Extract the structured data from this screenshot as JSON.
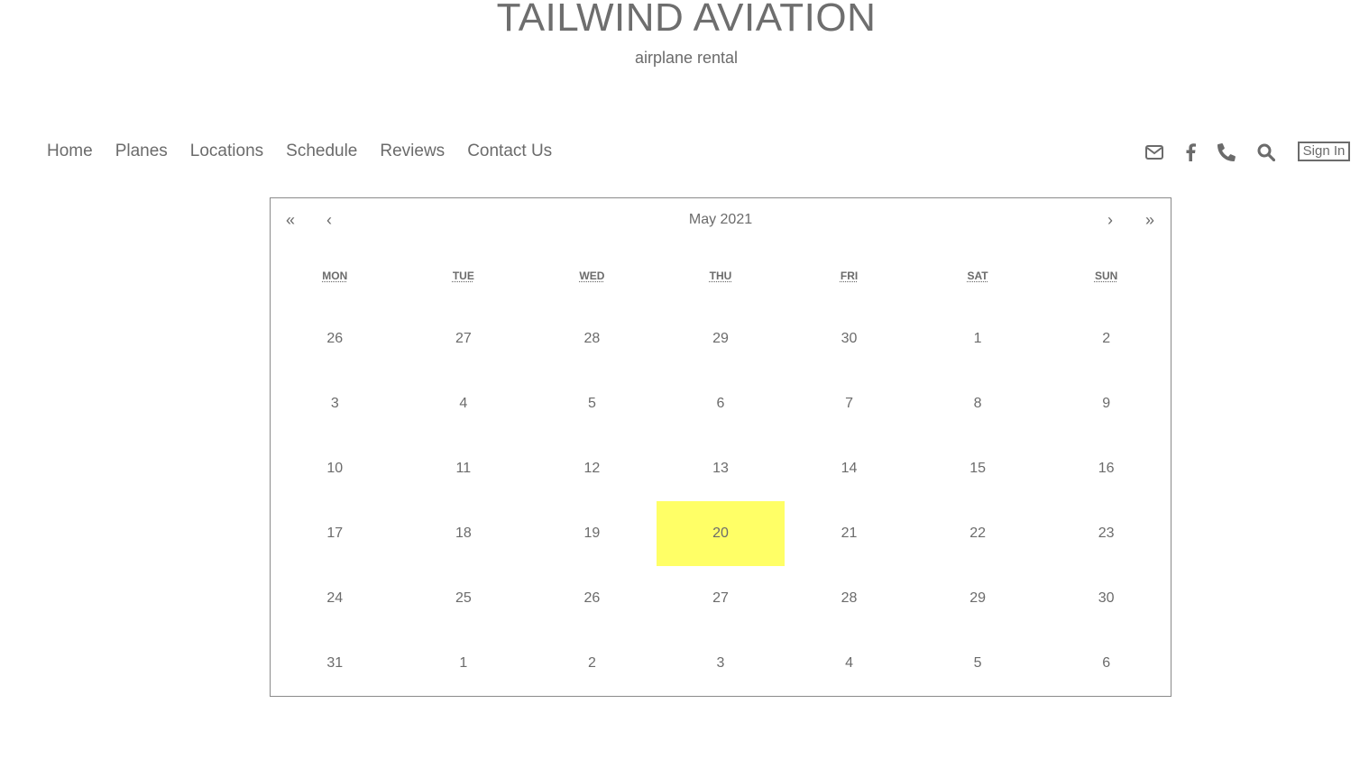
{
  "header": {
    "title": "TAILWIND AVIATION",
    "subtitle": "airplane rental"
  },
  "nav": {
    "items": [
      {
        "label": "Home"
      },
      {
        "label": "Planes"
      },
      {
        "label": "Locations"
      },
      {
        "label": "Schedule"
      },
      {
        "label": "Reviews"
      },
      {
        "label": "Contact Us"
      }
    ]
  },
  "toolbar": {
    "icons": [
      "envelope-icon",
      "facebook-icon",
      "phone-icon",
      "search-icon"
    ],
    "sign_in_label": "Sign In"
  },
  "calendar": {
    "prev_year": "«",
    "prev_month": "‹",
    "next_month": "›",
    "next_year": "»",
    "title": "May 2021",
    "weekdays": [
      "MON",
      "TUE",
      "WED",
      "THU",
      "FRI",
      "SAT",
      "SUN"
    ],
    "days": [
      "26",
      "27",
      "28",
      "29",
      "30",
      "1",
      "2",
      "3",
      "4",
      "5",
      "6",
      "7",
      "8",
      "9",
      "10",
      "11",
      "12",
      "13",
      "14",
      "15",
      "16",
      "17",
      "18",
      "19",
      "20",
      "21",
      "22",
      "23",
      "24",
      "25",
      "26",
      "27",
      "28",
      "29",
      "30",
      "31",
      "1",
      "2",
      "3",
      "4",
      "5",
      "6"
    ],
    "highlighted_day": "20",
    "highlight_color": "#ffff66"
  }
}
